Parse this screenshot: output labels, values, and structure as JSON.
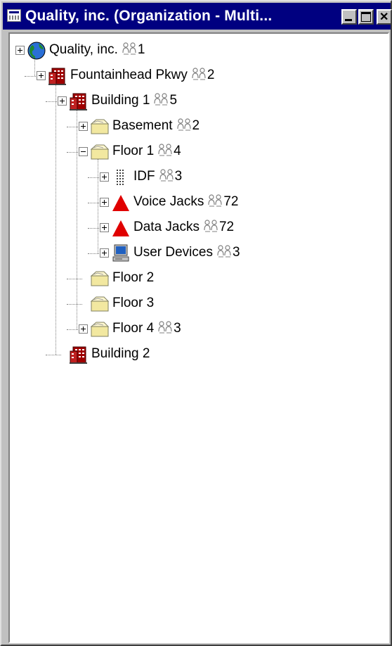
{
  "window": {
    "title": "Quality, inc. (Organization - Multi...",
    "icons": {
      "title": "window-list-icon",
      "minimize": "minimize-icon",
      "maximize": "maximize-icon",
      "close": "close-icon"
    }
  },
  "tree": {
    "nodes": [
      {
        "label": "Quality, inc.",
        "count": "1",
        "icon": "globe-icon",
        "expander": "plus"
      },
      {
        "label": "Fountainhead Pkwy",
        "count": "2",
        "icon": "building-icon",
        "expander": "plus"
      },
      {
        "label": "Building 1",
        "count": "5",
        "icon": "building-icon",
        "expander": "plus"
      },
      {
        "label": "Basement",
        "count": "2",
        "icon": "folder-icon",
        "expander": "plus"
      },
      {
        "label": "Floor 1",
        "count": "4",
        "icon": "folder-icon",
        "expander": "minus"
      },
      {
        "label": "IDF",
        "count": "3",
        "icon": "patch-panel-icon",
        "expander": "plus"
      },
      {
        "label": "Voice Jacks",
        "count": "72",
        "icon": "warning-triangle-icon",
        "expander": "plus"
      },
      {
        "label": "Data Jacks",
        "count": "72",
        "icon": "warning-triangle-icon",
        "expander": "plus"
      },
      {
        "label": "User Devices",
        "count": "3",
        "icon": "computer-icon",
        "expander": "plus"
      },
      {
        "label": "Floor 2",
        "count": "",
        "icon": "folder-icon",
        "expander": "none"
      },
      {
        "label": "Floor 3",
        "count": "",
        "icon": "folder-icon",
        "expander": "none"
      },
      {
        "label": "Floor 4",
        "count": "3",
        "icon": "folder-icon",
        "expander": "plus"
      },
      {
        "label": "Building 2",
        "count": "",
        "icon": "building-icon",
        "expander": "none"
      }
    ]
  },
  "colors": {
    "titlebar": "#000080",
    "alert": "#e00000",
    "building": "#a00000",
    "folder": "#f2e8a0"
  }
}
